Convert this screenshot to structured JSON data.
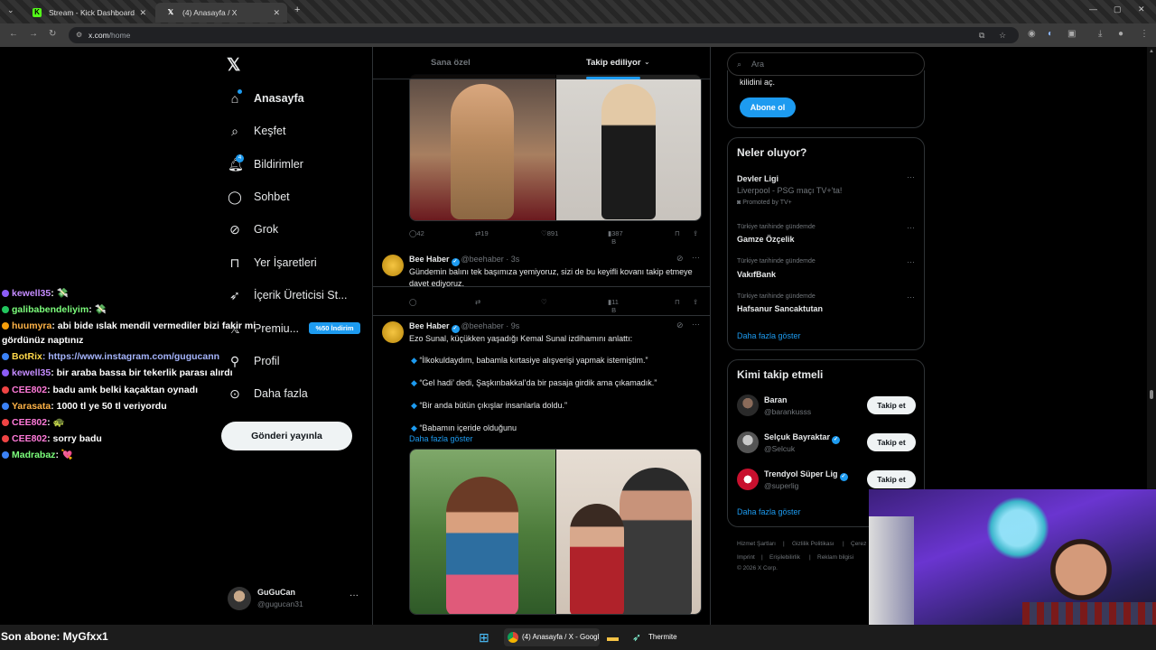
{
  "browser": {
    "tabs": [
      {
        "label": "Stream - Kick Dashboard",
        "active": false
      },
      {
        "label": "(4) Anasayfa / X",
        "active": true
      }
    ],
    "url_domain": "x.com",
    "url_path": "/home"
  },
  "sidebar": {
    "items": [
      {
        "label": "Anasayfa",
        "icon": "home-icon"
      },
      {
        "label": "Keşfet",
        "icon": "search-icon"
      },
      {
        "label": "Bildirimler",
        "icon": "bell-icon"
      },
      {
        "label": "Sohbet",
        "icon": "chat-icon"
      },
      {
        "label": "Grok",
        "icon": "grok-icon"
      },
      {
        "label": "Yer İşaretleri",
        "icon": "bookmark-icon"
      },
      {
        "label": "İçerik Üreticisi St...",
        "icon": "rocket-icon"
      },
      {
        "label": "Premiu...",
        "icon": "x-logo-icon"
      },
      {
        "label": "Profil",
        "icon": "profile-icon"
      },
      {
        "label": "Daha fazla",
        "icon": "more-circle-icon"
      }
    ],
    "premium_badge": "%50 İndirim",
    "post_button": "Gönderi yayınla",
    "account": {
      "name": "GuGuCan",
      "handle": "@gugucan31"
    }
  },
  "chat": [
    {
      "user": "kewell35",
      "message": ": 💸",
      "color": "#c58cff"
    },
    {
      "user": "galibabendeliyim",
      "message": ": 💸",
      "color": "#7cff7c"
    },
    {
      "user": "huumyra",
      "message": ": abi bide ıslak mendil vermediler bizi fakir mi",
      "color": "#ffb347"
    },
    {
      "user": "",
      "message": "gördünüz naptınız",
      "color": "#ffffff"
    },
    {
      "user": "BotRix",
      "message": ": https://www.instagram.com/gugucann",
      "color": "#ffd84a"
    },
    {
      "user": "kewell35",
      "message": ": bir araba bassa bir tekerlik parası alırdı",
      "color": "#c58cff"
    },
    {
      "user": "CEE802",
      "message": ": badu amk belki kaçaktan oynadı",
      "color": "#ff7ad9"
    },
    {
      "user": "Yarasata",
      "message": ": 1000 tl ye 50 tl veriyordu",
      "color": "#ffb347"
    },
    {
      "user": "CEE802",
      "message": ": 🐢",
      "color": "#ff7ad9"
    },
    {
      "user": "CEE802",
      "message": ": sorry badu",
      "color": "#ff7ad9"
    },
    {
      "user": "Madrabaz",
      "message": ": 💘",
      "color": "#7cff7c"
    }
  ],
  "feed": {
    "tabs": [
      {
        "label": "Sana özel"
      },
      {
        "label": "Takip ediliyor"
      }
    ],
    "post0_stats": {
      "replies": "42",
      "reposts": "19",
      "likes": "891",
      "views": "387 B"
    },
    "posts": [
      {
        "name": "Bee Haber",
        "handle": "@beehaber",
        "time": "· 3s",
        "text": "Gündemin balını tek başımıza yemiyoruz, sizi de bu keyifli kovanı takip etmeye davet ediyoruz.",
        "views": "11 B"
      },
      {
        "name": "Bee Haber",
        "handle": "@beehaber",
        "time": "· 9s",
        "text": "Ezo Sunal, küçükken yaşadığı Kemal Sunal izdihamını anlattı:",
        "bullets": [
          "“İlkokuldaydım, babamla kırtasiye alışverişi yapmak istemiştim.”",
          "“Gel hadi’ dedi, Şaşkınbakkal’da bir pasaja girdik ama çıkamadık.”",
          "“Bir anda bütün çıkışlar insanlarla doldu.”",
          "“Babamın içeride olduğunu"
        ],
        "more": "Daha fazla göster"
      }
    ]
  },
  "right": {
    "search_placeholder": "Ara",
    "premium_text": "kilidini aç.",
    "subscribe_button": "Abone ol",
    "trends_title": "Neler oluyor?",
    "trends": [
      {
        "context": "",
        "title": "Devler Ligi",
        "sub": "Liverpool - PSG maçı TV+'ta!",
        "promo": "Promoted by TV+"
      },
      {
        "context": "Türkiye tarihinde gündemde",
        "title": "Gamze Özçelik"
      },
      {
        "context": "Türkiye tarihinde gündemde",
        "title": "VakıfBank"
      },
      {
        "context": "Türkiye tarihinde gündemde",
        "title": "Hafsanur Sancaktutan"
      }
    ],
    "show_more": "Daha fazla göster",
    "who_title": "Kimi takip etmeli",
    "who": [
      {
        "name": "Baran",
        "handle": "@barankusss",
        "verified": false
      },
      {
        "name": "Selçuk Bayraktar",
        "handle": "@Selcuk",
        "verified": true
      },
      {
        "name": "Trendyol Süper Lig",
        "handle": "@superlig",
        "verified": true
      }
    ],
    "follow_label": "Takip et",
    "footer": [
      "Hizmet Şartları",
      "Gizlilik Politikası",
      "Çerez",
      "Imprint",
      "Erişilebilirlik",
      "Reklam bilgisi",
      "© 2026 X Corp."
    ]
  },
  "taskbar": {
    "last_sub": "Son abone: MyGfxx1",
    "chrome_label": "(4) Anasayfa / X - Googl",
    "thermite_label": "Thermite"
  },
  "colors": {
    "accent": "#1d9bf0",
    "bg": "#000000",
    "muted": "#71767b"
  }
}
